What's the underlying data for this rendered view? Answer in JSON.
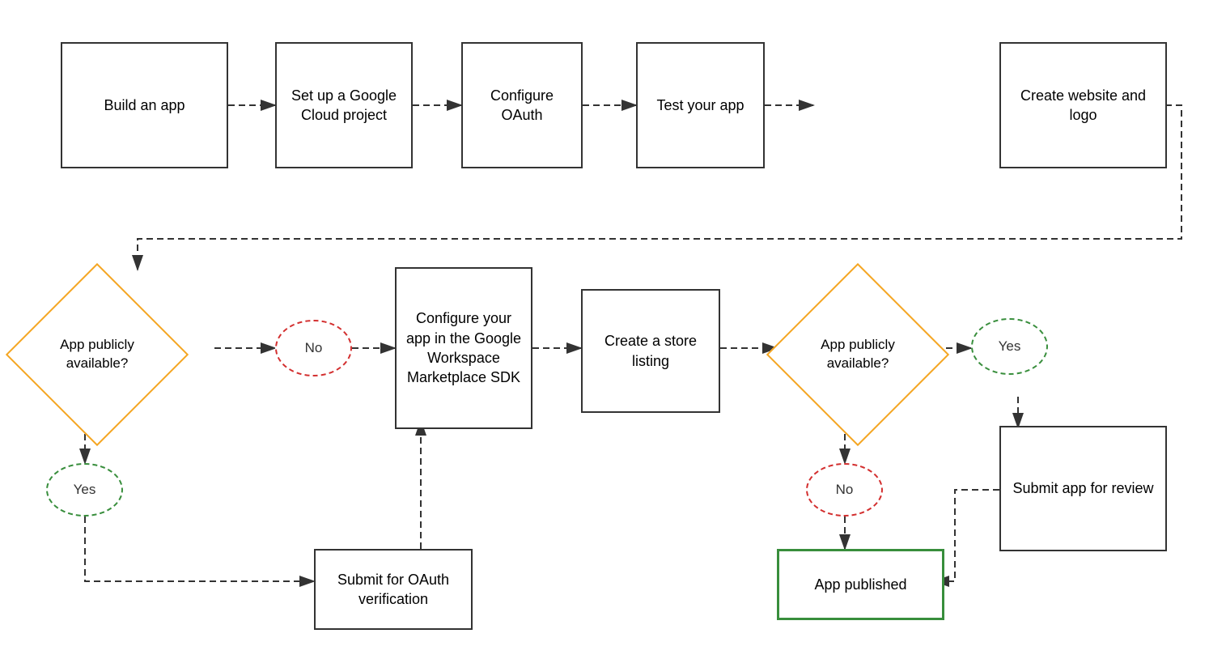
{
  "boxes": {
    "build_app": {
      "label": "Build\nan app"
    },
    "google_cloud": {
      "label": "Set up a\nGoogle Cloud\nproject"
    },
    "configure_oauth": {
      "label": "Configure\nOAuth"
    },
    "test_app": {
      "label": "Test\nyour\napp"
    },
    "create_website": {
      "label": "Create\nwebsite\nand logo"
    },
    "configure_workspace": {
      "label": "Configure your\napp in the\nGoogle\nWorkspace\nMarketplace\nSDK"
    },
    "create_store": {
      "label": "Create a\nstore listing"
    },
    "submit_oauth": {
      "label": "Submit for\nOAuth\nverification"
    },
    "submit_review": {
      "label": "Submit app\nfor review"
    },
    "app_published": {
      "label": "App published"
    }
  },
  "diamonds": {
    "app_available_1": {
      "label": "App\npublicly\navailable?"
    },
    "app_available_2": {
      "label": "App\npublicly\navailable?"
    }
  },
  "ovals": {
    "no_1": {
      "label": "No"
    },
    "yes_1": {
      "label": "Yes"
    },
    "no_2": {
      "label": "No"
    },
    "yes_2": {
      "label": "Yes"
    }
  }
}
